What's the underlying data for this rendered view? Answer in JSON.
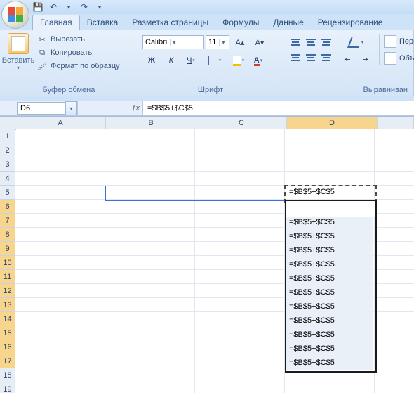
{
  "qat": {
    "save": "💾",
    "undo": "↶",
    "redo": "↷"
  },
  "tabs": {
    "home": "Главная",
    "insert": "Вставка",
    "layout": "Разметка страницы",
    "formulas": "Формулы",
    "data": "Данные",
    "review": "Рецензирование"
  },
  "ribbon": {
    "clipboard": {
      "paste": "Вставить",
      "cut": "Вырезать",
      "copy": "Копировать",
      "format_painter": "Формат по образцу",
      "group": "Буфер обмена"
    },
    "font": {
      "name": "Calibri",
      "size": "11",
      "bold": "Ж",
      "italic": "К",
      "underline": "Ч",
      "group": "Шрифт",
      "grow": "A▴",
      "shrink": "A▾"
    },
    "align": {
      "wrap": "Перенос",
      "merge": "Объедин",
      "group": "Выравниван"
    }
  },
  "name_box": "D6",
  "formula_bar": "=$B$5+$C$5",
  "columns": [
    "A",
    "B",
    "C",
    "D"
  ],
  "rows": [
    "1",
    "2",
    "3",
    "4",
    "5",
    "6",
    "7",
    "8",
    "9",
    "10",
    "11",
    "12",
    "13",
    "14",
    "15",
    "16",
    "17",
    "18",
    "19"
  ],
  "cells": {
    "D5": "=$B$5+$C$5",
    "D_range": [
      "=$B$5+$C$5",
      "=$B$5+$C$5",
      "=$B$5+$C$5",
      "=$B$5+$C$5",
      "=$B$5+$C$5",
      "=$B$5+$C$5",
      "=$B$5+$C$5",
      "=$B$5+$C$5",
      "=$B$5+$C$5",
      "=$B$5+$C$5",
      "=$B$5+$C$5",
      "=$B$5+$C$5"
    ]
  }
}
